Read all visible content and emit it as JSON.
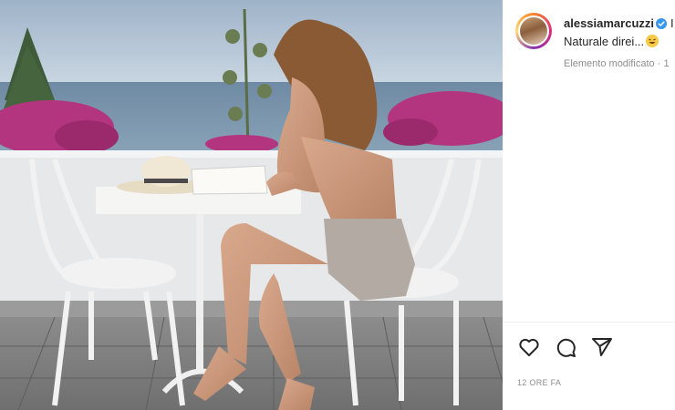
{
  "post": {
    "username": "alessiamarcuzzi",
    "caption": "Naturale direi...",
    "caption_emoji": "rofl-emoji",
    "edited_label": "Elemento modificato",
    "edited_suffix": "· 1",
    "more_glyph": "I",
    "timestamp": "12 ORE FA"
  },
  "icons": {
    "verified": "verified-badge-icon",
    "like": "heart-icon",
    "comment": "comment-bubble-icon",
    "share": "paper-plane-icon"
  },
  "colors": {
    "text": "#262626",
    "muted": "#8e8e8e",
    "verified": "#3897f0",
    "divider": "#efefef"
  }
}
